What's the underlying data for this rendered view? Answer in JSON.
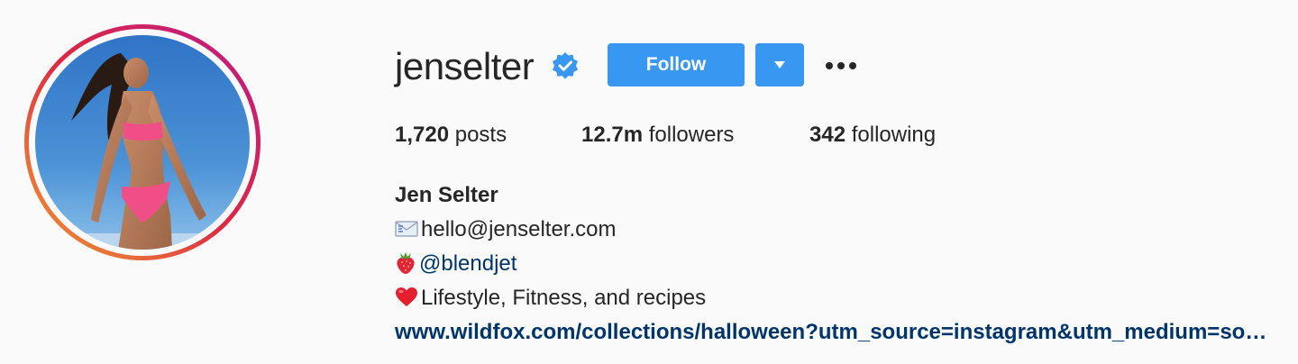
{
  "profile": {
    "username": "jenselter",
    "verified": true,
    "follow_label": "Follow",
    "stats": {
      "posts_count": "1,720",
      "posts_label": "posts",
      "followers_count": "12.7m",
      "followers_label": "followers",
      "following_count": "342",
      "following_label": "following"
    },
    "bio": {
      "full_name": "Jen Selter",
      "email": "hello@jenselter.com",
      "mention": "@blendjet",
      "tagline": "Lifestyle, Fitness, and recipes",
      "website": "www.wildfox.com/collections/halloween?utm_source=instagram&utm_medium=social&utm_campaign=halloween"
    },
    "icons": {
      "verified": "verified-badge-icon",
      "dropdown": "caret-down-icon",
      "more": "more-options-icon",
      "email": "envelope-icon",
      "mention": "strawberry-icon",
      "tagline": "red-heart-icon"
    },
    "colors": {
      "accent": "#3897f0",
      "link": "#003569",
      "text": "#262626",
      "background": "#fafafa"
    }
  }
}
